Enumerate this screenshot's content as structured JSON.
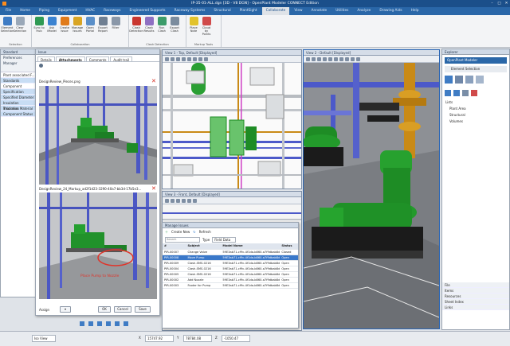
{
  "title": "IP-35-01-ALL.dgn [3D - V8 DGN] - OpenPlant Modeler CONNECT Edition",
  "title_controls": [
    "–",
    "□",
    "✕"
  ],
  "ribbon_tabs": [
    "File",
    "Home",
    "Piping",
    "Equipment",
    "HVAC",
    "Raceways",
    "Engineered Supports",
    "Raceway Systems",
    "Structural",
    "PlantSight",
    "Collaborate",
    "View",
    "Annotate",
    "Utilities",
    "Analyze",
    "Drawing Aids",
    "Help"
  ],
  "ribbon": {
    "groups": [
      {
        "label": "Selection",
        "items": [
          "Element Selection",
          "Clear Selection"
        ]
      },
      {
        "label": "Collaboration",
        "items": [
          "Sync to Hub",
          "Ask iModel",
          "Create Issue",
          "Manage Issues",
          "Open Portal",
          "Export Report",
          "Filter"
        ]
      },
      {
        "label": "Clash Detection",
        "items": [
          "Clash Detection",
          "Clash Results",
          "Run Clash",
          "Export Clash"
        ]
      },
      {
        "label": "Markup Tools",
        "items": [
          "Place Note",
          "Cloud by Points"
        ]
      }
    ]
  },
  "issue_panel": {
    "title": "Issue",
    "tabs": [
      "Details",
      "Attachments",
      "Comments",
      "Audit trail"
    ],
    "attachment1": "DesignReview_Pieces.png",
    "attachment2": "DesignReview_24_Markup_ad2f1d23-3290-40a7-bb3d-17b5e3...",
    "markup_label": "Place Pump to Nozzle",
    "assign_label": "Assign",
    "ok": "OK",
    "cancel": "Cancel",
    "save": "Save"
  },
  "left_panel": {
    "title": "Standard Preferences Manager",
    "items": [
      "Plant associated F...",
      "Standards",
      "Component",
      "Specification",
      "Specified Diameter",
      "Insulation Thickness",
      "Insulation Material",
      "Component Status"
    ]
  },
  "view1": {
    "title": "View 1 - Top, Default [Displayed]"
  },
  "view2": {
    "title": "View 2 - Default [Displayed]"
  },
  "view3": {
    "title": "View 3 - Front, Default [Displayed]"
  },
  "manage_issues": {
    "title": "Manage Issues",
    "create_label": "Create New",
    "refresh_label": "Refresh",
    "search_placeholder": "Search",
    "type_label": "Type",
    "type_value": "Field Data",
    "columns": [
      "#",
      "Subject",
      "Model Name",
      "Status"
    ],
    "rows": [
      [
        "PIR-00007",
        "Change Valve",
        "59E3ab71-cf9c-4f1da-b860-a7f9dbab8d5e",
        "Closed"
      ],
      [
        "PIR-00008",
        "Move Pump",
        "59E3ab71-cf9c-4f1da-b860-a7f9dbab8d5e",
        "Open"
      ],
      [
        "PIR-00009",
        "Clash-SMS-0216",
        "59E3ab71-cf9c-4f1da-b860-a7f9dbab8d5e",
        "Open"
      ],
      [
        "PIR-00004",
        "Clash-SMS-0216",
        "59E3ab71-cf9c-4f1da-b860-a7f9dbab8d5e",
        "Open"
      ],
      [
        "PIR-00005",
        "Clash-SMS-0216",
        "59E3ab71-cf9c-4f1da-b860-a7f9dbab8d5e",
        "Open"
      ],
      [
        "PIR-00002",
        "Add Nozzle",
        "59E3ab71-cf9c-4f1da-b860-a7f9dbab8d5e",
        "Open"
      ],
      [
        "PIR-00003",
        "Footer for Pump",
        "59E3ab71-cf9c-4f1da-b860-a7f9dbab8d5e",
        "Open"
      ]
    ],
    "selected_row": 1
  },
  "explorer": {
    "title": "Explorer",
    "subtitle": "OpenPlant Modeler",
    "selection_tab": "Element Selection",
    "tree_root": "Lists",
    "tree_items": [
      "Plant Area",
      "Structural",
      "Volumes"
    ],
    "bottom_sections": [
      "File",
      "Items",
      "Resources",
      "Sheet Index",
      "Links"
    ]
  },
  "status": {
    "view_label": "Iso View",
    "x_label": "X",
    "x_value": "15747.92",
    "y_label": "Y",
    "y_value": "78784.08",
    "z_label": "Z",
    "z_value": "-1050.47"
  },
  "colors": {
    "accent": "#1b4f8a",
    "pump_green": "#1e8c25",
    "pipe_blue": "#4c59c9",
    "valve_gold": "#c98a16",
    "selection_blue": "#3a78c9"
  }
}
